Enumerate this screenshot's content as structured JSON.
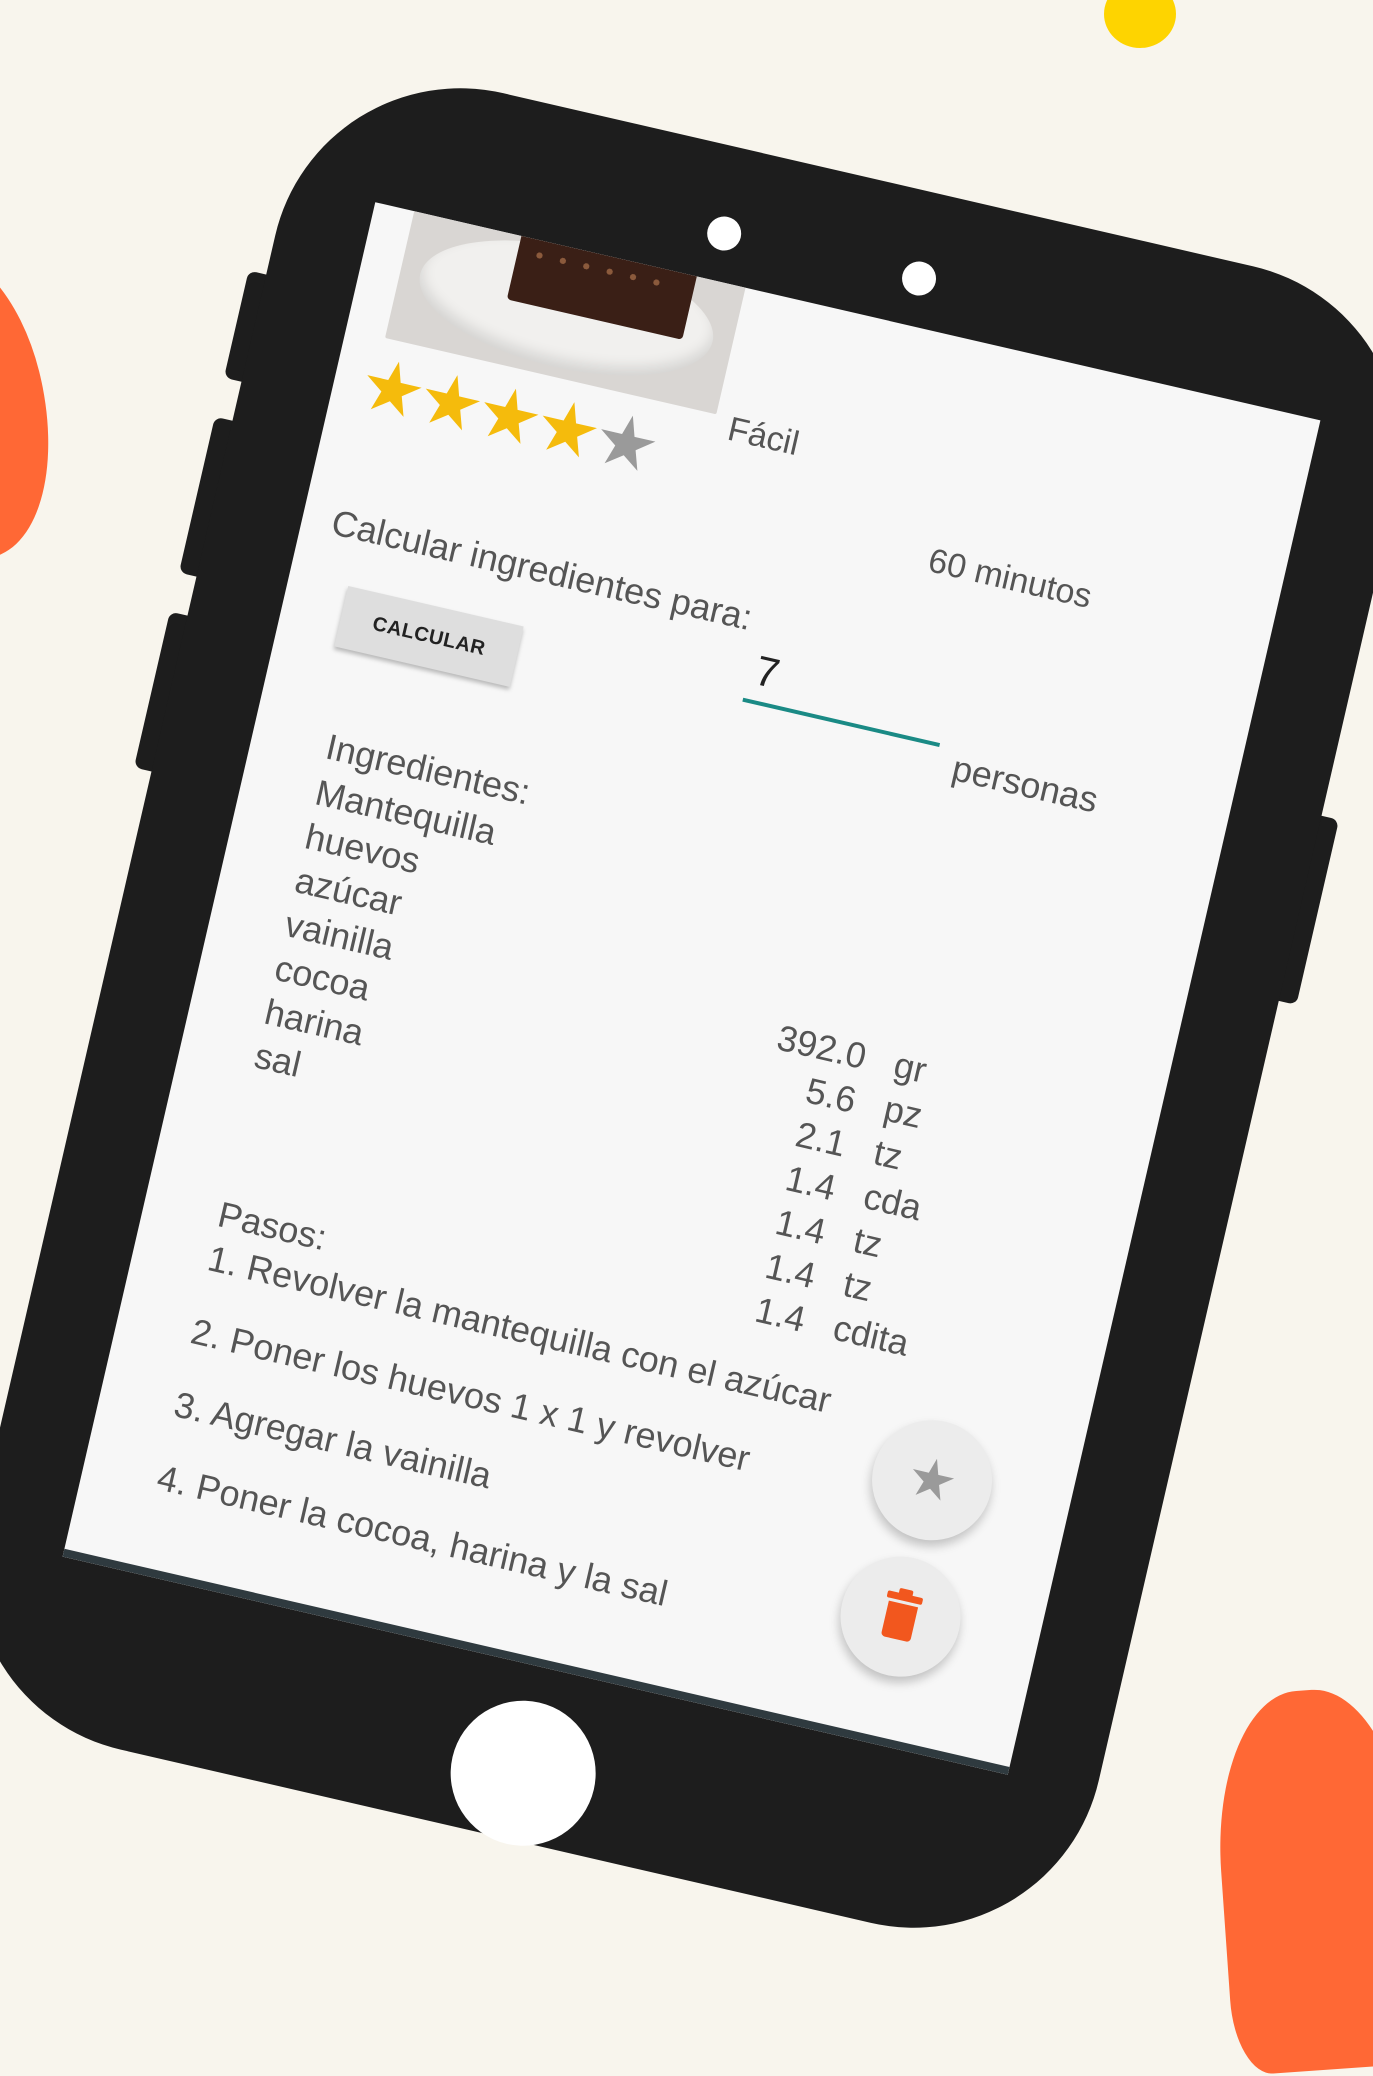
{
  "recipe": {
    "difficulty": "Fácil",
    "time": "60 minutos",
    "rating": 4,
    "rating_max": 5
  },
  "calculator": {
    "label": "Calcular ingredientes para:",
    "people_value": "7",
    "people_unit": "personas",
    "button_label": "CALCULAR"
  },
  "ingredients": {
    "title": "Ingredientes:",
    "items": [
      {
        "name": "Mantequilla",
        "qty": "392.0",
        "unit": "gr"
      },
      {
        "name": "huevos",
        "qty": "5.6",
        "unit": "pz"
      },
      {
        "name": "azúcar",
        "qty": "2.1",
        "unit": "tz"
      },
      {
        "name": "vainilla",
        "qty": "1.4",
        "unit": "cda"
      },
      {
        "name": "cocoa",
        "qty": "1.4",
        "unit": "tz"
      },
      {
        "name": "harina",
        "qty": "1.4",
        "unit": "tz"
      },
      {
        "name": "sal",
        "qty": "1.4",
        "unit": "cdita"
      }
    ]
  },
  "steps": {
    "title": "Pasos:",
    "items": [
      "1. Revolver la mantequilla con el azúcar",
      "2. Poner los huevos 1 x 1 y revolver",
      "3. Agregar la vainilla",
      "4. Poner la cocoa, harina y la sal"
    ]
  },
  "fabs": {
    "favorite_icon": "star-icon",
    "delete_icon": "trash-icon"
  },
  "colors": {
    "background": "#f8f5ed",
    "phone": "#1d1d1d",
    "accent_orange": "#ff6835",
    "accent_yellow": "#fed400",
    "star_on": "#f5bb0c",
    "star_off": "#9a9a9a",
    "input_underline": "#1a8a85",
    "delete_icon": "#f2571e"
  }
}
